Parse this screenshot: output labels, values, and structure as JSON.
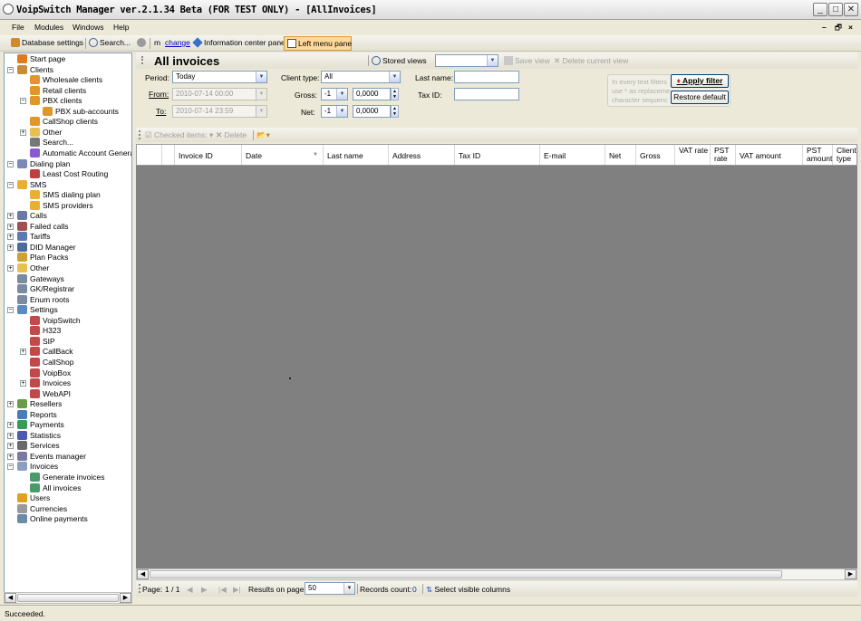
{
  "window": {
    "title": "VoipSwitch Manager ver.2.1.34 Beta (FOR TEST ONLY) - [AllInvoices]"
  },
  "menu": {
    "file": "File",
    "modules": "Modules",
    "windows": "Windows",
    "help": "Help"
  },
  "toolbar": {
    "db_settings": "Database settings",
    "search": "Search...",
    "m": "m",
    "change": "change",
    "info_pane": "Information center pane",
    "left_pane": "Left menu pane"
  },
  "tree": [
    {
      "label": "Start page",
      "icon": "start-icon"
    },
    {
      "label": "Clients",
      "icon": "clients-icon"
    },
    {
      "label": "Wholesale clients",
      "icon": "user-icon"
    },
    {
      "label": "Retail clients",
      "icon": "user-icon"
    },
    {
      "label": "PBX clients",
      "icon": "user-icon"
    },
    {
      "label": "PBX sub-accounts",
      "icon": "user-icon"
    },
    {
      "label": "CallShop clients",
      "icon": "user-icon"
    },
    {
      "label": "Other",
      "icon": "folder-icon"
    },
    {
      "label": "Search...",
      "icon": "search-icon"
    },
    {
      "label": "Automatic Account Generat",
      "icon": "wand-icon"
    },
    {
      "label": "Dialing plan",
      "icon": "dialing-icon"
    },
    {
      "label": "Least Cost Routing",
      "icon": "route-icon"
    },
    {
      "label": "SMS",
      "icon": "sms-icon"
    },
    {
      "label": "SMS dialing plan",
      "icon": "sms-icon"
    },
    {
      "label": "SMS providers",
      "icon": "sms-icon"
    },
    {
      "label": "Calls",
      "icon": "calls-icon"
    },
    {
      "label": "Failed calls",
      "icon": "failed-calls-icon"
    },
    {
      "label": "Tariffs",
      "icon": "tariffs-icon"
    },
    {
      "label": "DID Manager",
      "icon": "did-icon"
    },
    {
      "label": "Plan Packs",
      "icon": "plan-icon"
    },
    {
      "label": "Other",
      "icon": "folder-icon"
    },
    {
      "label": "Gateways",
      "icon": "gateway-icon"
    },
    {
      "label": "GK/Registrar",
      "icon": "gateway-icon"
    },
    {
      "label": "Enum roots",
      "icon": "gateway-icon"
    },
    {
      "label": "Settings",
      "icon": "settings-icon"
    },
    {
      "label": "VoipSwitch",
      "icon": "doc-icon"
    },
    {
      "label": "H323",
      "icon": "doc-icon"
    },
    {
      "label": "SIP",
      "icon": "doc-icon"
    },
    {
      "label": "CallBack",
      "icon": "doc-icon"
    },
    {
      "label": "CallShop",
      "icon": "doc-icon"
    },
    {
      "label": "VoipBox",
      "icon": "doc-icon"
    },
    {
      "label": "Invoices",
      "icon": "doc-icon"
    },
    {
      "label": "WebAPI",
      "icon": "doc-icon"
    },
    {
      "label": "Resellers",
      "icon": "resellers-icon"
    },
    {
      "label": "Reports",
      "icon": "reports-icon"
    },
    {
      "label": "Payments",
      "icon": "payments-icon"
    },
    {
      "label": "Statistics",
      "icon": "statistics-icon"
    },
    {
      "label": "Services",
      "icon": "services-icon"
    },
    {
      "label": "Events manager",
      "icon": "events-icon"
    },
    {
      "label": "Invoices",
      "icon": "invoices-icon"
    },
    {
      "label": "Generate invoices",
      "icon": "invoice-doc-icon"
    },
    {
      "label": "All invoices",
      "icon": "invoice-doc-icon"
    },
    {
      "label": "Users",
      "icon": "users-icon"
    },
    {
      "label": "Currencies",
      "icon": "currency-icon"
    },
    {
      "label": "Online payments",
      "icon": "card-icon"
    }
  ],
  "main": {
    "title": "All invoices",
    "stored_views": "Stored views",
    "save_view": "Save view",
    "delete_view": "Delete current view"
  },
  "filter": {
    "period_label": "Period:",
    "period_value": "Today",
    "from_label": "From:",
    "from_value": "2010-07-14 00:00",
    "to_label": "To:",
    "to_value": "2010-07-14 23:59",
    "client_type_label": "Client type:",
    "client_type_value": "All",
    "gross_label": "Gross:",
    "gross_op": "-1",
    "gross_value": "0,0000",
    "net_label": "Net:",
    "net_op": "-1",
    "net_value": "0,0000",
    "last_name_label": "Last name:",
    "tax_id_label": "Tax ID:",
    "hint_line1": "In every text filters",
    "hint_line2": "use * as replaceme",
    "hint_line3": "character sequenc",
    "apply_filter": "Apply filter",
    "restore_default": "Restore default"
  },
  "grid_toolbar": {
    "checked_items": "Checked items:",
    "delete": "Delete"
  },
  "grid": {
    "columns": [
      "Invoice ID",
      "Date",
      "Last name",
      "Address",
      "Tax ID",
      "E-mail",
      "Net",
      "Gross",
      "VAT rate",
      "PST rate",
      "VAT amount",
      "PST amount",
      "Client type"
    ]
  },
  "pager": {
    "page_label": "Page:",
    "page_value": "1 / 1",
    "results_label": "Results on page:",
    "results_value": "50",
    "records_label": "Records count:",
    "records_value": "0",
    "select_columns": "Select visible columns"
  },
  "status": {
    "text": "Succeeded."
  }
}
